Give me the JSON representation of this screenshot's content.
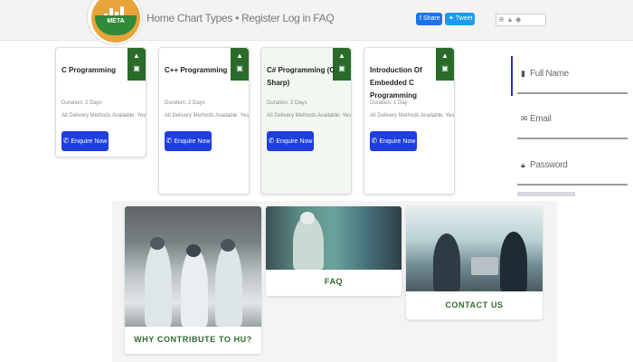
{
  "header": {
    "nav": [
      "Home",
      "Chart",
      "Types",
      "•",
      "Register",
      "Log in",
      "FAQ"
    ],
    "logo_text": "META",
    "share_label": "Share",
    "tweet_label": "Tweet",
    "lang_value": "",
    "colors": {
      "brand_green": "#2a6b2a",
      "accent_blue": "#1e3ee0"
    }
  },
  "courses": [
    {
      "title": "C Programming",
      "duration": "Duration: 2 Days",
      "delivery": "All Delivery Methods Available: Yes",
      "button": "Enquire Now"
    },
    {
      "title": "C++ Programming",
      "duration": "Duration: 2 Days",
      "delivery": "All Delivery Methods Available: Yes",
      "button": "Enquire Now"
    },
    {
      "title": "C# Programming (C Sharp)",
      "duration": "Duration: 2 Days",
      "delivery": "All Delivery Methods Available: Yes",
      "button": "Enquire Now"
    },
    {
      "title": "Introduction Of Embedded C Programming",
      "duration": "Duration: 1 Day",
      "delivery": "All Delivery Methods Available: Yes",
      "button": "Enquire Now"
    }
  ],
  "form": {
    "full_name": "Full Name",
    "email": "Email",
    "password": "Password"
  },
  "tiles": [
    {
      "label": "WHY CONTRIBUTE TO HU?"
    },
    {
      "label": "FAQ"
    },
    {
      "label": "CONTACT US"
    }
  ]
}
